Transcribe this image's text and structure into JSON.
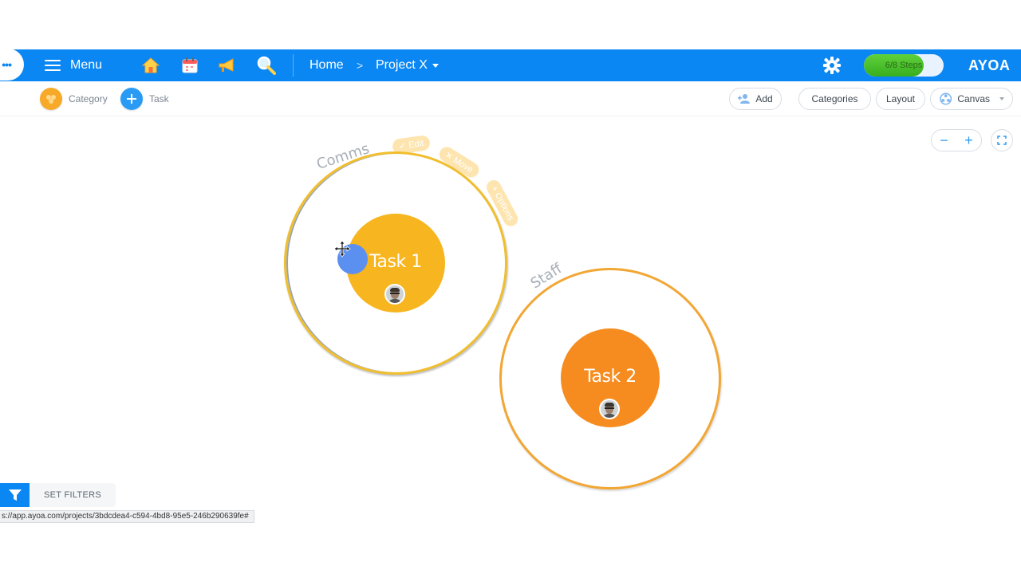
{
  "topbar": {
    "menu_label": "Menu",
    "icons": [
      "home-icon",
      "calendar-icon",
      "megaphone-icon",
      "search-icon"
    ],
    "breadcrumb": {
      "home": "Home",
      "separator": ">",
      "project": "Project X"
    },
    "steps": {
      "label": "6/8 Steps",
      "progress": 0.75
    },
    "brand": "AYOA",
    "color": "#0b87f3"
  },
  "toolbar": {
    "category_label": "Category",
    "task_label": "Task",
    "add_label": "Add",
    "categories_label": "Categories",
    "layout_label": "Layout",
    "canvas_label": "Canvas"
  },
  "zoom": {
    "minus": "−",
    "plus": "+"
  },
  "canvas": {
    "categories": [
      {
        "name": "Comms",
        "ring_color": "#f0be2e"
      },
      {
        "name": "Staff",
        "ring_color": "#f2a634"
      }
    ],
    "tasks": [
      {
        "name": "Task 1",
        "color": "#f7b51f"
      },
      {
        "name": "Task 2",
        "color": "#f68c1f"
      }
    ]
  },
  "filters": {
    "label": "SET FILTERS"
  },
  "status_bar": {
    "url": "s://app.ayoa.com/projects/3bdcdea4-c594-4bd8-95e5-246b290639fe#"
  }
}
